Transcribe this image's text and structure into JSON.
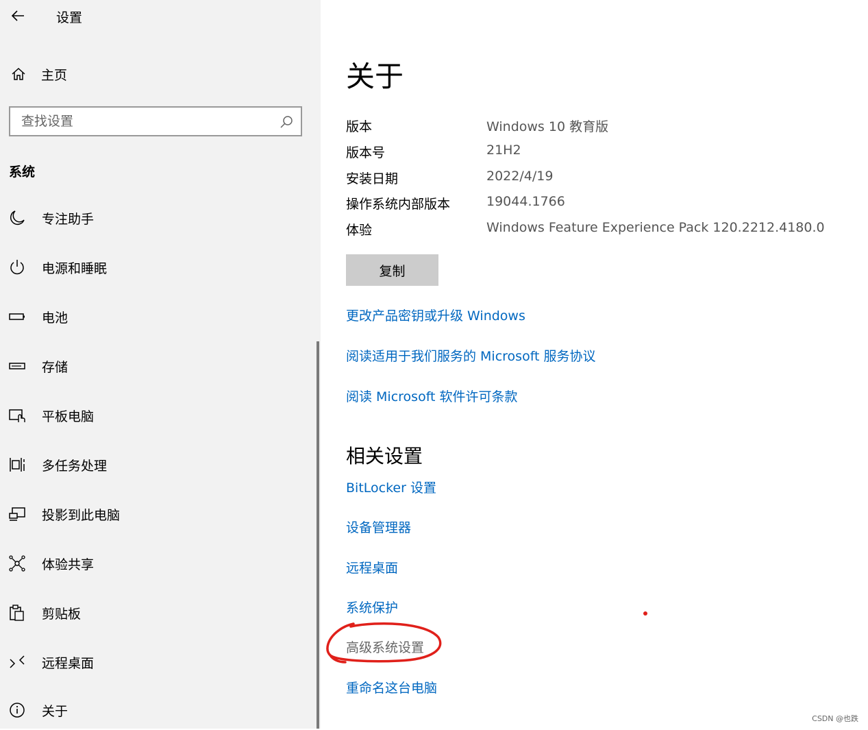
{
  "window": {
    "title": "设置"
  },
  "sidebar": {
    "home_label": "主页",
    "search_placeholder": "查找设置",
    "section_heading": "系统",
    "items": [
      {
        "label": "专注助手",
        "icon": "focus-assist-icon"
      },
      {
        "label": "电源和睡眠",
        "icon": "power-icon"
      },
      {
        "label": "电池",
        "icon": "battery-icon"
      },
      {
        "label": "存储",
        "icon": "storage-icon"
      },
      {
        "label": "平板电脑",
        "icon": "tablet-icon"
      },
      {
        "label": "多任务处理",
        "icon": "multitasking-icon"
      },
      {
        "label": "投影到此电脑",
        "icon": "projecting-icon"
      },
      {
        "label": "体验共享",
        "icon": "shared-experiences-icon"
      },
      {
        "label": "剪贴板",
        "icon": "clipboard-icon"
      },
      {
        "label": "远程桌面",
        "icon": "remote-desktop-icon"
      },
      {
        "label": "关于",
        "icon": "info-icon"
      }
    ]
  },
  "main": {
    "title": "关于",
    "specs": [
      {
        "key": "版本",
        "value": "Windows 10 教育版"
      },
      {
        "key": "版本号",
        "value": "21H2"
      },
      {
        "key": "安装日期",
        "value": "2022/4/19"
      },
      {
        "key": "操作系统内部版本",
        "value": "19044.1766"
      },
      {
        "key": "体验",
        "value": "Windows Feature Experience Pack 120.2212.4180.0"
      }
    ],
    "copy_button": "复制",
    "links": [
      "更改产品密钥或升级 Windows",
      "阅读适用于我们服务的 Microsoft 服务协议",
      "阅读 Microsoft 软件许可条款"
    ],
    "related_heading": "相关设置",
    "related_links": [
      "BitLocker 设置",
      "设备管理器",
      "远程桌面",
      "系统保护",
      "高级系统设置",
      "重命名这台电脑"
    ]
  },
  "colors": {
    "sidebar_bg": "#f2f2f2",
    "link": "#0067c0",
    "annotation": "#e0201a"
  },
  "watermark": "CSDN @也跌"
}
